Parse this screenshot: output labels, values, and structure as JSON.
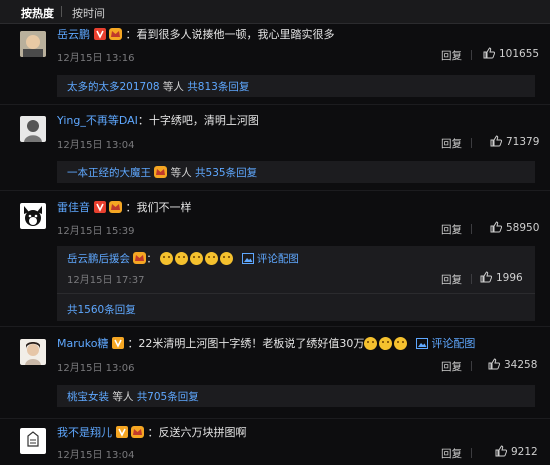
{
  "tabs": {
    "hot": "按热度",
    "time": "按时间"
  },
  "comments": [
    {
      "user": "岳云鹏",
      "text": "：看到很多人说揍他一顿，我心里踏实很多",
      "time": "12月15日 13:16",
      "reply": "回复",
      "likes": "101655",
      "thread": {
        "users": "太多的太多201708",
        "mid": " 等人 ",
        "count": "共813条回复"
      }
    },
    {
      "user": "Ying_不再等DAI",
      "text": "：十字绣吧，清明上河图",
      "time": "12月15日 13:04",
      "reply": "回复",
      "likes": "71379",
      "thread": {
        "users": "一本正经的大魔王",
        "mid": " 等人 ",
        "count": "共535条回复"
      }
    },
    {
      "user": "雷佳音",
      "text": "：我们不一样",
      "time": "12月15日 15:39",
      "reply": "回复",
      "likes": "58950",
      "sub": {
        "user": "岳云鹏后援会",
        "colon": "：",
        "pic_link": "评论配图",
        "time": "12月15日 17:37",
        "reply": "回复",
        "likes": "1996",
        "count": "共1560条回复"
      }
    },
    {
      "user": "Maruko糖",
      "text": "：22米清明上河图十字绣！老板说了绣好值30万",
      "pic_link": "评论配图",
      "time": "12月15日 13:06",
      "reply": "回复",
      "likes": "34258",
      "thread": {
        "users": "桃宝女装",
        "mid": " 等人 ",
        "count": "共705条回复"
      }
    },
    {
      "user": "我不是翔儿",
      "text": "：反送六万块拼图啊",
      "time": "12月15日 13:04",
      "reply": "回复",
      "likes": "9212"
    }
  ],
  "colors": {
    "link": "#5fa8ff",
    "bg": "#0d0d0f",
    "reply_bg": "#1c1c1f",
    "vip": "#f5a623",
    "verified": "#e8402f"
  }
}
